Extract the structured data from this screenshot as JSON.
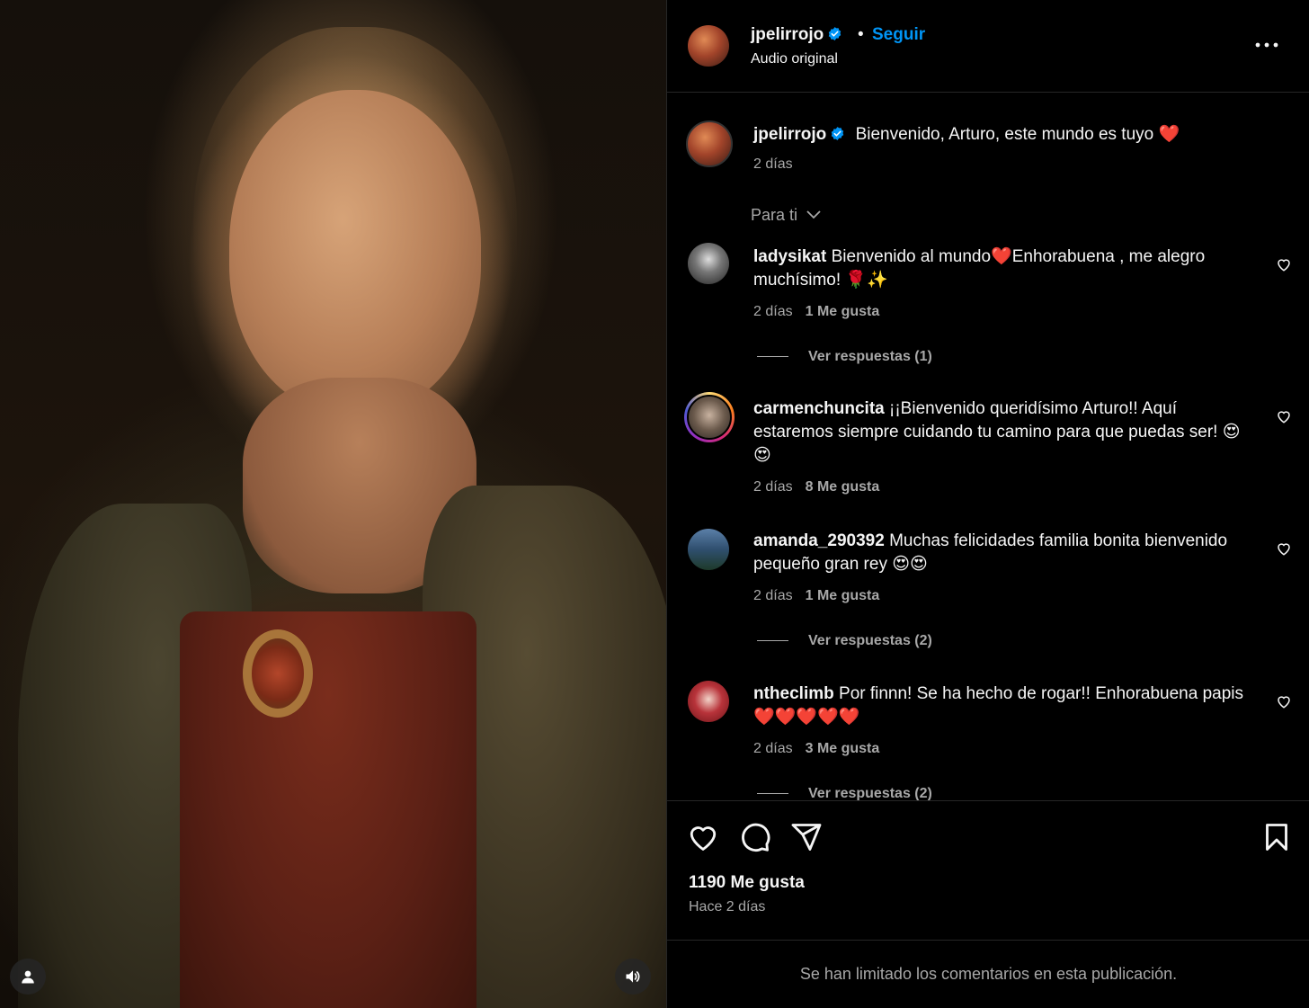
{
  "header": {
    "username": "jpelirrojo",
    "separator": "•",
    "follow_label": "Seguir",
    "audio_label": "Audio original"
  },
  "caption": {
    "username": "jpelirrojo",
    "text": "Bienvenido, Arturo, este mundo es tuyo ❤️",
    "time": "2 días"
  },
  "sort_label": "Para ti",
  "comments": [
    {
      "username": "ladysikat",
      "text": "Bienvenido al mundo❤️Enhorabuena , me alegro muchísimo! 🌹✨",
      "time": "2 días",
      "likes": "1 Me gusta",
      "replies": "Ver respuestas (1)"
    },
    {
      "username": "carmenchuncita",
      "text": "¡¡Bienvenido queridísimo Arturo!! Aquí estaremos siempre cuidando tu camino para que puedas ser! 😍😍",
      "time": "2 días",
      "likes": "8 Me gusta"
    },
    {
      "username": "amanda_290392",
      "text": "Muchas felicidades familia bonita bienvenido pequeño gran rey 😍😍",
      "time": "2 días",
      "likes": "1 Me gusta",
      "replies": "Ver respuestas (2)"
    },
    {
      "username": "ntheclimb",
      "text": "Por finnn! Se ha hecho de rogar!! Enhorabuena papis ❤️❤️❤️❤️❤️",
      "time": "2 días",
      "likes": "3 Me gusta",
      "replies": "Ver respuestas (2)"
    }
  ],
  "actions": {
    "likes_total": "1190 Me gusta",
    "posted_ago": "Hace 2 días"
  },
  "footer": {
    "limited_notice": "Se han limitado los comentarios en esta publicación."
  },
  "colors": {
    "accent": "#0095f6",
    "verified": "#0095f6",
    "muted_text": "#a8a8a8",
    "divider": "#262626"
  },
  "icons": [
    "verified-badge-icon",
    "more-options-icon",
    "chevron-down-icon",
    "heart-icon",
    "comment-icon",
    "share-icon",
    "bookmark-icon",
    "user-tag-icon",
    "volume-icon"
  ]
}
